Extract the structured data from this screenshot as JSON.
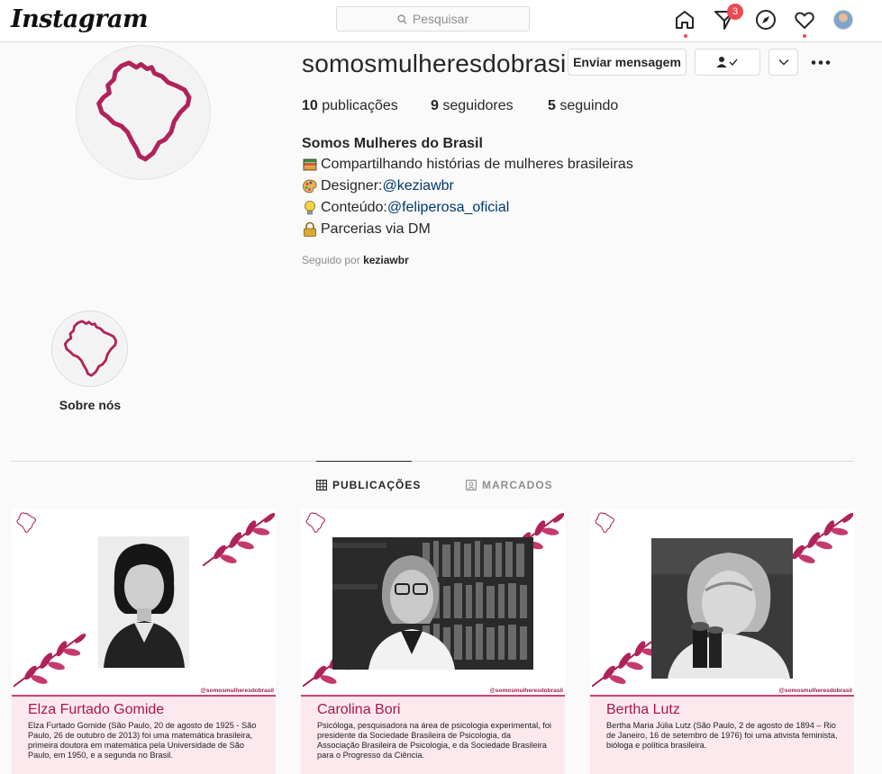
{
  "app": {
    "logo": "Instagram"
  },
  "search": {
    "placeholder": "Pesquisar"
  },
  "nav": {
    "notification_count": "3"
  },
  "profile": {
    "username": "somosmulheresdobrasil",
    "buttons": {
      "message": "Enviar mensagem"
    },
    "stats": {
      "posts_count": "10",
      "posts_label": "publicações",
      "followers_count": "9",
      "followers_label": "seguidores",
      "following_count": "5",
      "following_label": "seguindo"
    },
    "full_name": "Somos Mulheres do Brasil",
    "bio": {
      "line1": "Compartilhando histórias de mulheres brasileiras",
      "line2_prefix": " Designer: ",
      "line2_mention": "@keziawbr",
      "line3_prefix": " Conteúdo: ",
      "line3_mention": "@feliperosa_oficial",
      "line4": "Parcerias via DM"
    },
    "followed_by_prefix": "Seguido por ",
    "followed_by_user": "keziawbr"
  },
  "highlights": [
    {
      "label": "Sobre nós"
    }
  ],
  "tabs": [
    {
      "label": "PUBLICAÇÕES"
    },
    {
      "label": "MARCADOS"
    }
  ],
  "posts": [
    {
      "name": "Elza Furtado Gomide",
      "handle": "@somosmulheresdobrasil",
      "text": "Elza Furtado Gomide (São Paulo, 20 de agosto de 1925 - São Paulo, 26 de outubro de 2013) foi uma matemática brasileira, primeira doutora em matemática pela Universidade de São Paulo, em 1950, e a segunda no Brasil."
    },
    {
      "name": "Carolina Bori",
      "handle": "@somosmulheresdobrasil",
      "text": "Psicóloga, pesquisadora na área de psicologia experimental, foi presidente da Sociedade Brasileira de Psicologia, da Associação Brasileira de Psicologia, e da Sociedade Brasileira para o Progresso da Ciência."
    },
    {
      "name": "Bertha Lutz",
      "handle": "@somosmulheresdobrasil",
      "text": "Bertha Maria Júlia Lutz (São Paulo, 2 de agosto de 1894 – Rio de Janeiro, 16 de setembro de 1976) foi uma ativista feminista, bióloga e política brasileira."
    }
  ],
  "colors": {
    "brand_pink": "#b0235a",
    "link": "#00376b",
    "badge": "#ed4956"
  }
}
